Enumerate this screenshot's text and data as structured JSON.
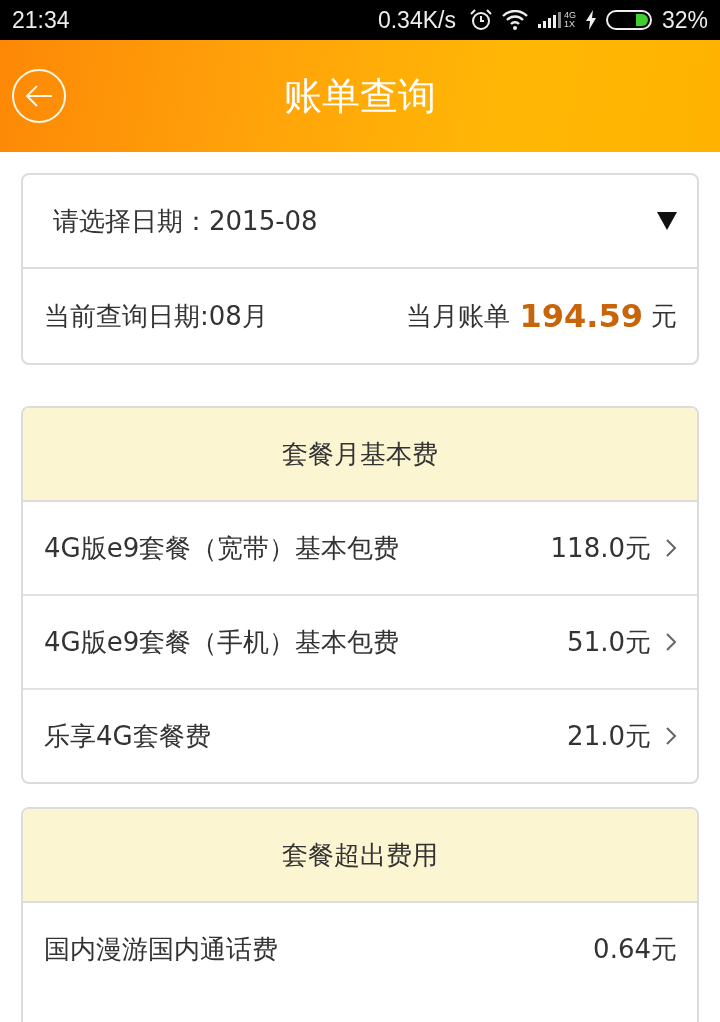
{
  "status_bar": {
    "time": "21:34",
    "speed": "0.34K/s",
    "network_labels": [
      "4G",
      "1X"
    ],
    "battery": "32%"
  },
  "header": {
    "title": "账单查询"
  },
  "query_card": {
    "date_picker": {
      "label": "请选择日期：2015-08"
    },
    "current_date": "当前查询日期:08月",
    "bill_label": "当月账单",
    "bill_amount": "194.59",
    "bill_unit": "元"
  },
  "sections": [
    {
      "title": "套餐月基本费",
      "items": [
        {
          "name": "4G版e9套餐（宽带）基本包费",
          "amount": "118.0元",
          "kind": "detail"
        },
        {
          "name": "4G版e9套餐（手机）基本包费",
          "amount": "51.0元",
          "kind": "detail"
        },
        {
          "name": "乐享4G套餐费",
          "amount": "21.0元",
          "kind": "detail"
        }
      ]
    },
    {
      "title": "套餐超出费用",
      "items": [
        {
          "name": "国内漫游国内通话费",
          "amount": "0.64元",
          "kind": "plain"
        }
      ]
    }
  ]
}
